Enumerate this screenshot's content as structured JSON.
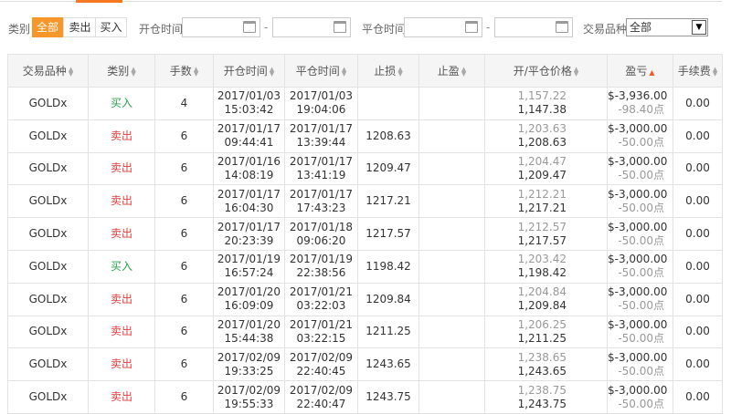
{
  "filters": {
    "category_label": "类别",
    "tabs": [
      "全部",
      "卖出",
      "买入"
    ],
    "active_tab": "全部",
    "open_time_label": "开仓时间",
    "close_time_label": "平仓时间",
    "dash": "-",
    "symbol_label": "交易品种",
    "symbol_value": "全部"
  },
  "table": {
    "headers": [
      "交易品种",
      "类别",
      "手数",
      "开仓时间",
      "平仓时间",
      "止损",
      "止盈",
      "开/平仓价格",
      "盈亏",
      "手续费"
    ],
    "rows": [
      {
        "symbol": "GOLDx",
        "side": "买入",
        "type": "buy",
        "lots": "4",
        "open_date": "2017/01/03",
        "open_time": "15:03:42",
        "close_date": "2017/01/03",
        "close_time": "19:04:06",
        "sl": "",
        "tp": "",
        "open_price": "1,157.22",
        "close_price": "1,147.38",
        "pl": "$-3,936.00",
        "pts": "-98.40点",
        "fee": "0.00"
      },
      {
        "symbol": "GOLDx",
        "side": "卖出",
        "type": "sell",
        "lots": "6",
        "open_date": "2017/01/17",
        "open_time": "09:44:41",
        "close_date": "2017/01/17",
        "close_time": "13:39:44",
        "sl": "1208.63",
        "tp": "",
        "open_price": "1,203.63",
        "close_price": "1,208.63",
        "pl": "$-3,000.00",
        "pts": "-50.00点",
        "fee": "0.00"
      },
      {
        "symbol": "GOLDx",
        "side": "卖出",
        "type": "sell",
        "lots": "6",
        "open_date": "2017/01/16",
        "open_time": "14:08:19",
        "close_date": "2017/01/17",
        "close_time": "13:41:19",
        "sl": "1209.47",
        "tp": "",
        "open_price": "1,204.47",
        "close_price": "1,209.47",
        "pl": "$-3,000.00",
        "pts": "-50.00点",
        "fee": "0.00"
      },
      {
        "symbol": "GOLDx",
        "side": "卖出",
        "type": "sell",
        "lots": "6",
        "open_date": "2017/01/17",
        "open_time": "16:04:30",
        "close_date": "2017/01/17",
        "close_time": "17:43:23",
        "sl": "1217.21",
        "tp": "",
        "open_price": "1,212.21",
        "close_price": "1,217.21",
        "pl": "$-3,000.00",
        "pts": "-50.00点",
        "fee": "0.00"
      },
      {
        "symbol": "GOLDx",
        "side": "卖出",
        "type": "sell",
        "lots": "6",
        "open_date": "2017/01/17",
        "open_time": "20:23:39",
        "close_date": "2017/01/18",
        "close_time": "09:06:20",
        "sl": "1217.57",
        "tp": "",
        "open_price": "1,212.57",
        "close_price": "1,217.57",
        "pl": "$-3,000.00",
        "pts": "-50.00点",
        "fee": "0.00"
      },
      {
        "symbol": "GOLDx",
        "side": "买入",
        "type": "buy",
        "lots": "6",
        "open_date": "2017/01/19",
        "open_time": "16:57:24",
        "close_date": "2017/01/19",
        "close_time": "22:38:56",
        "sl": "1198.42",
        "tp": "",
        "open_price": "1,203.42",
        "close_price": "1,198.42",
        "pl": "$-3,000.00",
        "pts": "-50.00点",
        "fee": "0.00"
      },
      {
        "symbol": "GOLDx",
        "side": "卖出",
        "type": "sell",
        "lots": "6",
        "open_date": "2017/01/20",
        "open_time": "16:09:09",
        "close_date": "2017/01/21",
        "close_time": "03:22:03",
        "sl": "1209.84",
        "tp": "",
        "open_price": "1,204.84",
        "close_price": "1,209.84",
        "pl": "$-3,000.00",
        "pts": "-50.00点",
        "fee": "0.00"
      },
      {
        "symbol": "GOLDx",
        "side": "卖出",
        "type": "sell",
        "lots": "6",
        "open_date": "2017/01/20",
        "open_time": "15:44:38",
        "close_date": "2017/01/21",
        "close_time": "03:22:15",
        "sl": "1211.25",
        "tp": "",
        "open_price": "1,206.25",
        "close_price": "1,211.25",
        "pl": "$-3,000.00",
        "pts": "-50.00点",
        "fee": "0.00"
      },
      {
        "symbol": "GOLDx",
        "side": "卖出",
        "type": "sell",
        "lots": "6",
        "open_date": "2017/02/09",
        "open_time": "19:33:25",
        "close_date": "2017/02/09",
        "close_time": "22:40:45",
        "sl": "1243.65",
        "tp": "",
        "open_price": "1,238.65",
        "close_price": "1,243.65",
        "pl": "$-3,000.00",
        "pts": "-50.00点",
        "fee": "0.00"
      },
      {
        "symbol": "GOLDx",
        "side": "卖出",
        "type": "sell",
        "lots": "6",
        "open_date": "2017/02/09",
        "open_time": "19:55:33",
        "close_date": "2017/02/09",
        "close_time": "22:40:47",
        "sl": "1243.75",
        "tp": "",
        "open_price": "1,238.75",
        "close_price": "1,243.75",
        "pl": "$-3,000.00",
        "pts": "-50.00点",
        "fee": "0.00"
      }
    ]
  },
  "icons": {
    "calendar": "calendar-icon",
    "sort": "sort-icon",
    "sort_asc": "sort-asc-icon",
    "dropdown": "chevron-down-icon"
  },
  "colors": {
    "accent": "#f7972a",
    "buy": "#2aa34f",
    "sell": "#e33e3e",
    "sort_active": "#f25c27"
  }
}
